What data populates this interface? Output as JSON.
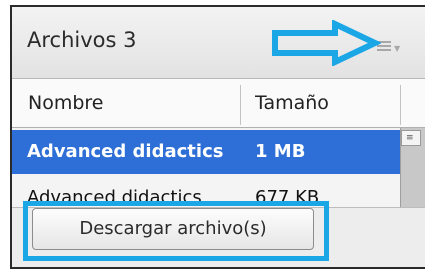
{
  "panel": {
    "title": "Archivos 3",
    "menu_icon": "hamburger-menu-icon"
  },
  "table": {
    "columns": [
      "Nombre",
      "Tamaño"
    ],
    "rows": [
      {
        "name": "Advanced didactics",
        "size": "1 MB",
        "selected": true
      },
      {
        "name": "Advanced didactics",
        "size": "677 KB",
        "selected": false
      }
    ]
  },
  "footer": {
    "download_button": "Descargar archivo(s)"
  },
  "colors": {
    "selection": "#2d6fd6",
    "annotation": "#1ba7e6"
  }
}
